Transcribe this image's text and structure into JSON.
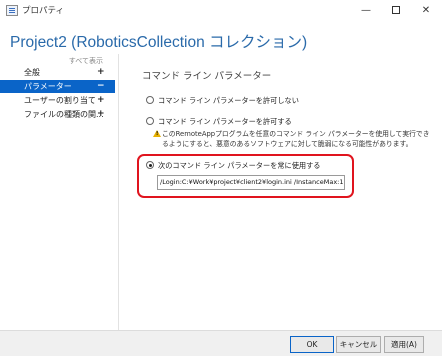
{
  "window": {
    "title": "プロパティ",
    "minimize": "—",
    "close": "✕"
  },
  "page_title": "Project2 (RoboticsCollection コレクション)",
  "sidebar": {
    "show_all": "すべて表示",
    "items": [
      {
        "label": "全般",
        "toggle": "+",
        "selected": false
      },
      {
        "label": "パラメーター",
        "toggle": "−",
        "selected": true
      },
      {
        "label": "ユーザーの割り当て",
        "toggle": "+",
        "selected": false
      },
      {
        "label": "ファイルの種類の関...",
        "toggle": "+",
        "selected": false
      }
    ]
  },
  "main": {
    "section_title": "コマンド ライン パラメーター",
    "options": [
      {
        "label": "コマンド ライン パラメーターを許可しない",
        "checked": false
      },
      {
        "label": "コマンド ライン パラメーターを許可する",
        "checked": false
      },
      {
        "label": "次のコマンド ライン パラメーターを常に使用する",
        "checked": true
      }
    ],
    "warning_text": "このRemoteAppプログラムを任意のコマンド ライン パラメーターを使用して実行できるようにすると、悪意のあるソフトウェアに対して脆弱になる可能性があります。",
    "parameter_value": "/Login:C:¥Work¥project¥client2¥login.ini /InstanceMax:1",
    "highlight_color": "#e0141e"
  },
  "footer": {
    "ok": "OK",
    "cancel": "キャンセル",
    "apply": "適用(A)"
  },
  "colors": {
    "accent": "#0a64c8",
    "title": "#2a6aaa",
    "warning": "#e8b100"
  }
}
